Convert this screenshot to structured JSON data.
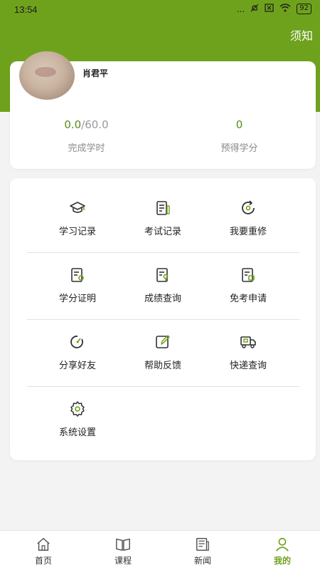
{
  "status_bar": {
    "time": "13:54",
    "dots": "...",
    "battery": "92"
  },
  "header": {
    "notice_label": "须知"
  },
  "profile": {
    "name": "肖君平",
    "completed_hours": "0.0",
    "total_hours": "/60.0",
    "completed_label": "完成学时",
    "expected_credits": "0",
    "expected_label": "预得学分"
  },
  "menu": [
    {
      "label": "学习记录",
      "icon": "graduation-cap-icon"
    },
    {
      "label": "考试记录",
      "icon": "exam-record-icon"
    },
    {
      "label": "我要重修",
      "icon": "retake-icon"
    },
    {
      "label": "学分证明",
      "icon": "certificate-icon"
    },
    {
      "label": "成绩查询",
      "icon": "score-query-icon"
    },
    {
      "label": "免考申请",
      "icon": "exemption-icon"
    },
    {
      "label": "分享好友",
      "icon": "share-icon"
    },
    {
      "label": "帮助反馈",
      "icon": "feedback-icon"
    },
    {
      "label": "快递查询",
      "icon": "delivery-truck-icon"
    },
    {
      "label": "系统设置",
      "icon": "gear-icon"
    }
  ],
  "bottom_nav": [
    {
      "label": "首页",
      "icon": "home-icon"
    },
    {
      "label": "课程",
      "icon": "book-icon"
    },
    {
      "label": "新闻",
      "icon": "news-icon"
    },
    {
      "label": "我的",
      "icon": "user-icon"
    }
  ],
  "colors": {
    "brand_green": "#6ea21d",
    "accent_green": "#5a8c1a"
  }
}
